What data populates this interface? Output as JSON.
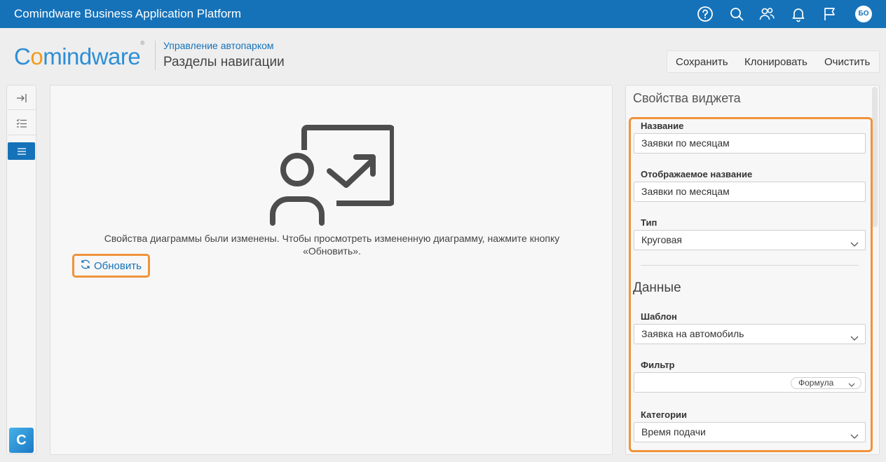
{
  "app": {
    "title": "Comindware Business Application Platform"
  },
  "topbar": {
    "icons": [
      "help-icon",
      "search-icon",
      "users-icon",
      "bell-icon",
      "flag-icon"
    ],
    "avatar_initials": "БО"
  },
  "header": {
    "logo_text": {
      "before": "C",
      "o": "o",
      "after": "mindware",
      "reg": "®"
    },
    "breadcrumb": "Управление автопарком",
    "page_title": "Разделы навигации"
  },
  "toolbar": {
    "save_label": "Сохранить",
    "clone_label": "Клонировать",
    "clear_label": "Очистить"
  },
  "rail": {
    "icons": [
      "collapse-icon",
      "checklist-icon",
      "list-icon"
    ],
    "active": "list-icon",
    "app_button": "C"
  },
  "main": {
    "message": "Свойства диаграммы были изменены. Чтобы просмотреть измененную диаграмму, нажмите кнопку «Обновить».",
    "refresh_label": "Обновить"
  },
  "props": {
    "title": "Свойства виджета",
    "name_label": "Название",
    "name_value": "Заявки по месяцам",
    "display_name_label": "Отображаемое название",
    "display_name_value": "Заявки по месяцам",
    "type_label": "Тип",
    "type_value": "Круговая",
    "data_section": "Данные",
    "template_label": "Шаблон",
    "template_value": "Заявка на автомобиль",
    "filter_label": "Фильтр",
    "filter_value": "",
    "formula_label": "Формула",
    "categories_label": "Категории",
    "categories_value": "Время подачи"
  },
  "colors": {
    "accent": "#1572b9",
    "highlight": "#f0933b"
  }
}
